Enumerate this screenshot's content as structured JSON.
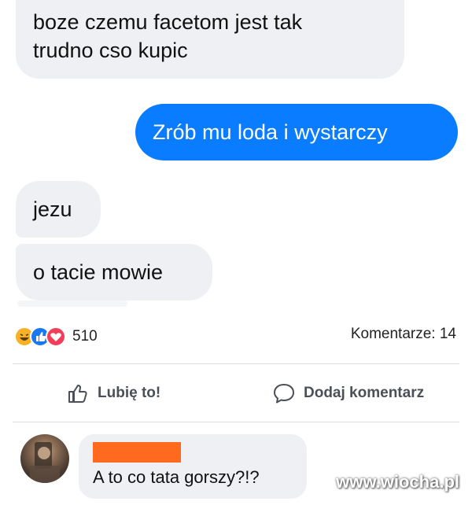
{
  "messages": [
    {
      "side": "in",
      "text_line1": "boze czemu facetom jest tak",
      "text_line2": "trudno cso kupic"
    },
    {
      "side": "out",
      "text": "Zrób mu loda i wystarczy"
    },
    {
      "side": "in",
      "text": "jezu"
    },
    {
      "side": "in",
      "text": "o tacie mowie"
    }
  ],
  "reactions": {
    "icons": [
      "haha-icon",
      "like-icon",
      "love-icon"
    ],
    "count": "510",
    "comments_label": "Komentarze: 14"
  },
  "actions": {
    "like_label": "Lubię to!",
    "comment_label": "Dodaj komentarz"
  },
  "comment": {
    "text": "A to co tata gorszy?!?"
  },
  "watermark": "www.wiocha.pl",
  "colors": {
    "outgoing_bubble": "#0a7cff",
    "incoming_bubble": "#eef0f3",
    "redaction": "#ff6a1f"
  }
}
